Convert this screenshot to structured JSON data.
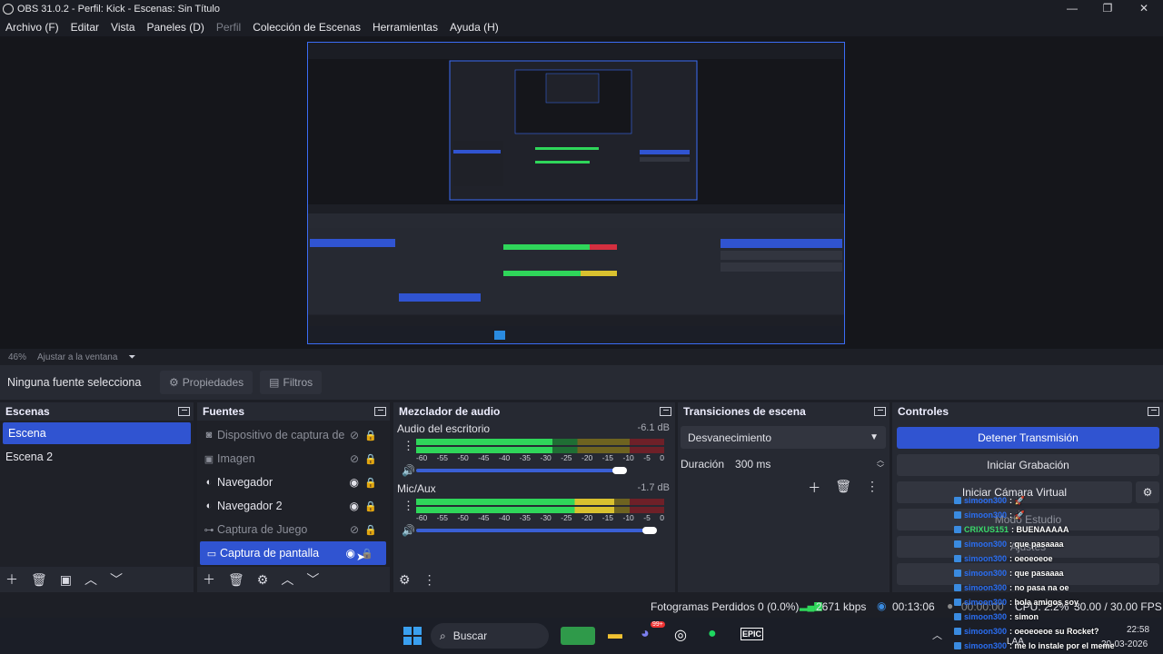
{
  "window": {
    "title": "OBS 31.0.2 - Perfil: Kick - Escenas: Sin Título",
    "minimize": "—",
    "maximize": "❐",
    "close": "✕"
  },
  "menu": {
    "items": [
      {
        "label": "Archivo (F)",
        "disabled": false
      },
      {
        "label": "Editar",
        "disabled": false
      },
      {
        "label": "Vista",
        "disabled": false
      },
      {
        "label": "Paneles (D)",
        "disabled": false
      },
      {
        "label": "Perfil",
        "disabled": true
      },
      {
        "label": "Colección de Escenas",
        "disabled": false
      },
      {
        "label": "Herramientas",
        "disabled": false
      },
      {
        "label": "Ayuda (H)",
        "disabled": false
      }
    ]
  },
  "zoom": {
    "value": "46%",
    "fit": "Ajustar a la ventana",
    "arrow": "⏷"
  },
  "source_toolbar": {
    "no_source": "Ninguna fuente selecciona",
    "properties": "Propiedades",
    "filters": "Filtros"
  },
  "scenes": {
    "title": "Escenas",
    "items": [
      {
        "label": "Escena",
        "selected": true
      },
      {
        "label": "Escena 2",
        "selected": false
      }
    ]
  },
  "sources": {
    "title": "Fuentes",
    "items": [
      {
        "label": "Dispositivo de captura de",
        "icon": "camera-icon",
        "glyph": "◙",
        "visible": false,
        "dim": true,
        "selected": false
      },
      {
        "label": "Imagen",
        "icon": "image-icon",
        "glyph": "▣",
        "visible": false,
        "dim": true,
        "selected": false
      },
      {
        "label": "Navegador",
        "icon": "globe-icon",
        "glyph": "◐",
        "visible": true,
        "dim": false,
        "selected": false
      },
      {
        "label": "Navegador 2",
        "icon": "globe-icon",
        "glyph": "◐",
        "visible": true,
        "dim": false,
        "selected": false
      },
      {
        "label": "Captura de Juego",
        "icon": "gamepad-icon",
        "glyph": "⊶",
        "visible": false,
        "dim": true,
        "selected": false
      },
      {
        "label": "Captura de pantalla",
        "icon": "monitor-icon",
        "glyph": "▭",
        "visible": true,
        "dim": false,
        "selected": true
      }
    ]
  },
  "mixer": {
    "title": "Mezclador de audio",
    "ticks": [
      "-60",
      "-55",
      "-50",
      "-45",
      "-40",
      "-35",
      "-30",
      "-25",
      "-20",
      "-15",
      "-10",
      "-5",
      "0"
    ],
    "channels": [
      {
        "name": "Audio del escritorio",
        "db": "-6.1 dB",
        "level": 0.55,
        "volume": 0.82
      },
      {
        "name": "Mic/Aux",
        "db": "-1.7 dB",
        "level": 0.8,
        "volume": 0.94
      }
    ]
  },
  "transitions": {
    "title": "Transiciones de escena",
    "selected": "Desvanecimiento",
    "duration_label": "Duración",
    "duration_value": "300 ms"
  },
  "controls": {
    "title": "Controles",
    "stop_stream": "Detener Transmisión",
    "start_recording": "Iniciar Grabación",
    "virtual_cam": "Iniciar Cámara Virtual",
    "studio_mode": "Modo Estudio",
    "settings": "Ajustes"
  },
  "status": {
    "dropped": "Fotogramas Perdidos 0 (0.0%)",
    "kbps": "2671 kbps",
    "stream_time": "00:13:06",
    "rec_time": "00:00:00",
    "cpu": "CPU: 2.2%",
    "fps": "30.00 / 30.00 FPS"
  },
  "taskbar": {
    "search": "Buscar",
    "time": "22:58",
    "date": "20-03-2026",
    "lang": "LAA",
    "badge": "99+"
  },
  "chat": [
    {
      "user": "simoon300",
      "msg": ": 🚀",
      "green": false
    },
    {
      "user": "simoon300",
      "msg": ": 🚀",
      "green": false
    },
    {
      "user": "CRIXUS151",
      "msg": ": BUENAAAAA",
      "green": true
    },
    {
      "user": "simoon300",
      "msg": ": que pasaaaa",
      "green": false
    },
    {
      "user": "simoon300",
      "msg": ": oeoeoeoe",
      "green": false
    },
    {
      "user": "simoon300",
      "msg": ": que pasaaaa",
      "green": false
    },
    {
      "user": "simoon300",
      "msg": ": no pasa na oe",
      "green": false
    },
    {
      "user": "simoon300",
      "msg": ": hola amigos soy",
      "green": false
    },
    {
      "user": "simoon300",
      "msg": ": simon",
      "green": false
    },
    {
      "user": "simoon300",
      "msg": ": oeoeoeoe su Rocket?",
      "green": false
    },
    {
      "user": "simoon300",
      "msg": ": me lo instale por el meme",
      "green": false
    }
  ],
  "colors": {
    "accent": "#3054d1",
    "meter_green": "#2fd65a",
    "meter_yellow": "#d9c12f",
    "meter_red": "#d42f3f"
  }
}
